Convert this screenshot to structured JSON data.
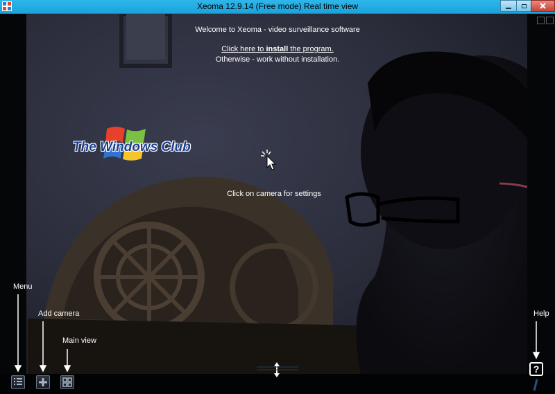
{
  "window": {
    "title": "Xeoma 12.9.14 (Free mode) Real time view",
    "controls": [
      "minimize-icon",
      "maximize-icon",
      "close-icon"
    ]
  },
  "overlay": {
    "welcome": "Welcome to Xeoma - video surveillance software",
    "install_prefix": "Click here to ",
    "install_bold": "install",
    "install_suffix": " the program.",
    "otherwise": "Otherwise - work without installation.",
    "camera_hint": "Click on camera for settings"
  },
  "watermark": {
    "text": "The Windows Club"
  },
  "annotations": {
    "menu": "Menu",
    "add_camera": "Add camera",
    "main_view": "Main view",
    "help": "Help"
  },
  "toolbar": {
    "menu_icon": "menu-list-icon",
    "add_icon": "plus-icon",
    "view_icon": "grid-view-icon",
    "help_label": "?"
  },
  "colors": {
    "titlebar": "#1aa3dd",
    "logo_text": "#1c3e8f"
  }
}
